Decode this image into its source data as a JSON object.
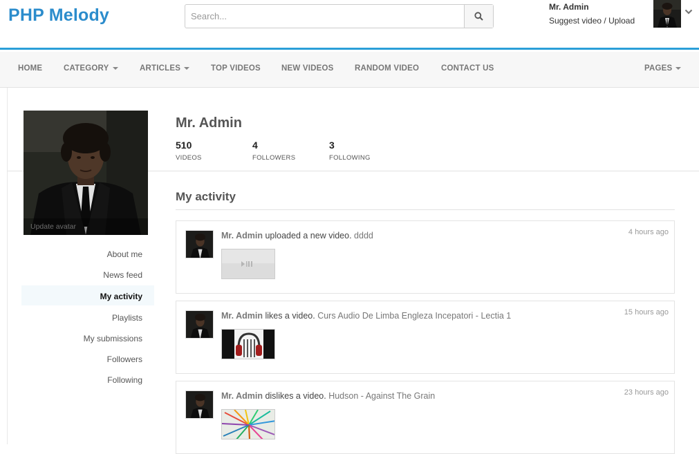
{
  "brand": {
    "logo": "PHP Melody"
  },
  "search": {
    "placeholder": "Search..."
  },
  "user": {
    "name": "Mr. Admin",
    "suggest_label": "Suggest video",
    "separator": "/",
    "upload_label": "Upload"
  },
  "nav": {
    "home": "HOME",
    "category": "CATEGORY",
    "articles": "ARTICLES",
    "top_videos": "TOP VIDEOS",
    "new_videos": "NEW VIDEOS",
    "random_video": "RANDOM VIDEO",
    "contact_us": "CONTACT US",
    "pages": "PAGES"
  },
  "profile": {
    "name": "Mr. Admin",
    "update_avatar": "Update avatar",
    "stats": [
      {
        "value": "510",
        "label": "VIDEOS"
      },
      {
        "value": "4",
        "label": "FOLLOWERS"
      },
      {
        "value": "3",
        "label": "FOLLOWING"
      }
    ]
  },
  "side_menu": [
    {
      "label": "About me"
    },
    {
      "label": "News feed"
    },
    {
      "label": "My activity",
      "active": true
    },
    {
      "label": "Playlists"
    },
    {
      "label": "My submissions"
    },
    {
      "label": "Followers"
    },
    {
      "label": "Following"
    }
  ],
  "activity": {
    "title": "My activity",
    "items": [
      {
        "user": "Mr. Admin",
        "action": "uploaded a new video.",
        "video": "dddd",
        "time": "4 hours ago",
        "thumb": "player-placeholder"
      },
      {
        "user": "Mr. Admin",
        "action": "likes a video.",
        "video": "Curs Audio De Limba Engleza Incepatori - Lectia 1",
        "time": "15 hours ago",
        "thumb": "headphones"
      },
      {
        "user": "Mr. Admin",
        "action": "dislikes a video.",
        "video": "Hudson - Against The Grain",
        "time": "23 hours ago",
        "thumb": "color-pencils"
      }
    ]
  },
  "colors": {
    "accent": "#2b9fd8",
    "logo": "#2b8ccc",
    "nav_bg": "#f7f7f7"
  }
}
